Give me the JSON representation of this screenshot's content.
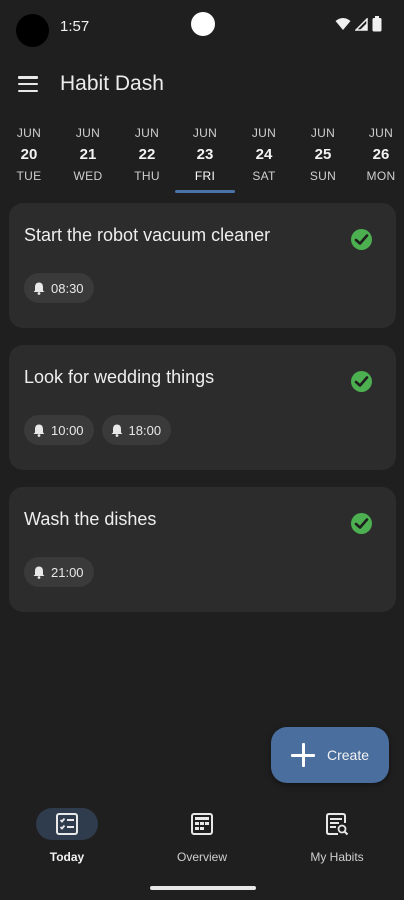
{
  "status_bar": {
    "time": "1:57"
  },
  "app_bar": {
    "title": "Habit Dash"
  },
  "dates": [
    {
      "month": "JUN",
      "day": "20",
      "weekday": "TUE",
      "selected": false
    },
    {
      "month": "JUN",
      "day": "21",
      "weekday": "WED",
      "selected": false
    },
    {
      "month": "JUN",
      "day": "22",
      "weekday": "THU",
      "selected": false
    },
    {
      "month": "JUN",
      "day": "23",
      "weekday": "FRI",
      "selected": true
    },
    {
      "month": "JUN",
      "day": "24",
      "weekday": "SAT",
      "selected": false
    },
    {
      "month": "JUN",
      "day": "25",
      "weekday": "SUN",
      "selected": false
    },
    {
      "month": "JUN",
      "day": "26",
      "weekday": "MON",
      "selected": false
    }
  ],
  "habits": [
    {
      "title": "Start the robot vacuum cleaner",
      "reminders": [
        "08:30"
      ],
      "completed": true
    },
    {
      "title": "Look for wedding things",
      "reminders": [
        "10:00",
        "18:00"
      ],
      "completed": true
    },
    {
      "title": "Wash the dishes",
      "reminders": [
        "21:00"
      ],
      "completed": true
    }
  ],
  "fab": {
    "label": "Create",
    "icon": "plus-icon"
  },
  "bottom_nav": [
    {
      "label": "Today",
      "icon": "checklist-icon",
      "active": true
    },
    {
      "label": "Overview",
      "icon": "calendar-grid-icon",
      "active": false
    },
    {
      "label": "My Habits",
      "icon": "list-search-icon",
      "active": false
    }
  ],
  "colors": {
    "background": "#1f1f1f",
    "card": "#2c2c2c",
    "accent": "#4a73a8",
    "fab": "#4a6e9e",
    "check": "#4caf50"
  }
}
